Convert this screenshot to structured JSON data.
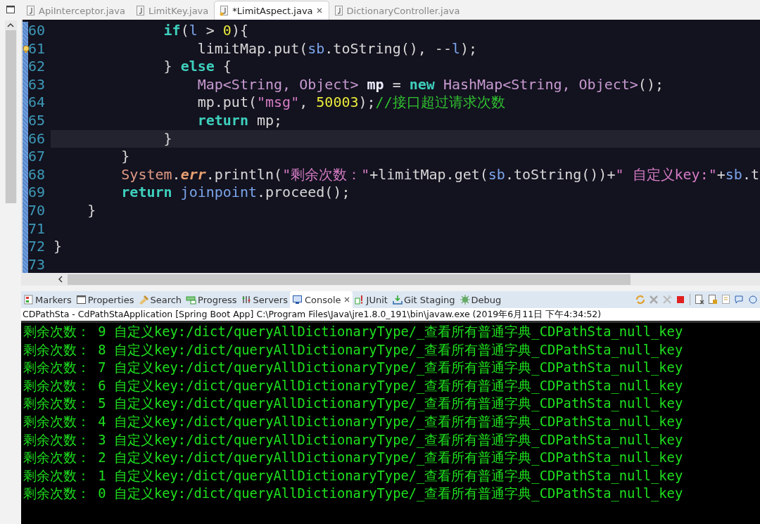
{
  "editor_tabs": [
    {
      "label": "ApiInterceptor.java",
      "selected": false
    },
    {
      "label": "LimitKey.java",
      "selected": false
    },
    {
      "label": "*LimitAspect.java",
      "selected": true
    },
    {
      "label": "DictionaryController.java",
      "selected": false
    }
  ],
  "code_lines": [
    {
      "number": "60",
      "current": false,
      "warning": false,
      "tokens": [
        {
          "kind": "kw",
          "text": "             if"
        },
        {
          "kind": "plain",
          "text": "("
        },
        {
          "kind": "var",
          "text": "l"
        },
        {
          "kind": "plain",
          "text": " > "
        },
        {
          "kind": "num",
          "text": "0"
        },
        {
          "kind": "plain",
          "text": "){"
        }
      ]
    },
    {
      "number": "61",
      "current": false,
      "warning": true,
      "tokens": [
        {
          "kind": "plain",
          "text": "                 limitMap.put("
        },
        {
          "kind": "var",
          "text": "sb"
        },
        {
          "kind": "plain",
          "text": ".toString(), --"
        },
        {
          "kind": "var",
          "text": "l"
        },
        {
          "kind": "plain",
          "text": ");"
        }
      ]
    },
    {
      "number": "62",
      "current": false,
      "warning": false,
      "tokens": [
        {
          "kind": "plain",
          "text": "             } "
        },
        {
          "kind": "kw",
          "text": "else"
        },
        {
          "kind": "plain",
          "text": " {"
        }
      ]
    },
    {
      "number": "63",
      "current": false,
      "warning": false,
      "tokens": [
        {
          "kind": "type",
          "text": "                 Map<String, Object>"
        },
        {
          "kind": "decl",
          "text": " mp"
        },
        {
          "kind": "plain",
          "text": " = "
        },
        {
          "kind": "kw",
          "text": "new"
        },
        {
          "kind": "type",
          "text": " HashMap<String, Object>"
        },
        {
          "kind": "plain",
          "text": "();"
        }
      ]
    },
    {
      "number": "64",
      "current": false,
      "warning": false,
      "tokens": [
        {
          "kind": "plain",
          "text": "                 mp.put("
        },
        {
          "kind": "str",
          "text": "\"msg\""
        },
        {
          "kind": "plain",
          "text": ", "
        },
        {
          "kind": "num",
          "text": "50003"
        },
        {
          "kind": "plain",
          "text": ");"
        },
        {
          "kind": "cmt",
          "text": "//接口超过请求次数"
        }
      ]
    },
    {
      "number": "65",
      "current": false,
      "warning": false,
      "tokens": [
        {
          "kind": "kw",
          "text": "                 return"
        },
        {
          "kind": "plain",
          "text": " mp;"
        }
      ]
    },
    {
      "number": "66",
      "current": true,
      "warning": false,
      "tokens": [
        {
          "kind": "plain",
          "text": "             }"
        }
      ]
    },
    {
      "number": "67",
      "current": false,
      "warning": false,
      "tokens": [
        {
          "kind": "plain",
          "text": "        }"
        }
      ]
    },
    {
      "number": "68",
      "current": false,
      "warning": false,
      "tokens": [
        {
          "kind": "cls",
          "text": "        System"
        },
        {
          "kind": "plain",
          "text": "."
        },
        {
          "kind": "fld",
          "text": "err"
        },
        {
          "kind": "plain",
          "text": ".println("
        },
        {
          "kind": "str",
          "text": "\"剩余次数：\""
        },
        {
          "kind": "plain",
          "text": "+limitMap.get("
        },
        {
          "kind": "var",
          "text": "sb"
        },
        {
          "kind": "plain",
          "text": ".toString())+"
        },
        {
          "kind": "str",
          "text": "\" 自定义key:\""
        },
        {
          "kind": "plain",
          "text": "+"
        },
        {
          "kind": "var",
          "text": "sb"
        },
        {
          "kind": "plain",
          "text": ".t"
        }
      ]
    },
    {
      "number": "69",
      "current": false,
      "warning": false,
      "tokens": [
        {
          "kind": "kw",
          "text": "        return"
        },
        {
          "kind": "var",
          "text": " joinpoint"
        },
        {
          "kind": "plain",
          "text": ".proceed();"
        }
      ]
    },
    {
      "number": "70",
      "current": false,
      "warning": false,
      "tokens": [
        {
          "kind": "plain",
          "text": "    }"
        }
      ]
    },
    {
      "number": "71",
      "current": false,
      "warning": false
    },
    {
      "number": "72",
      "current": false,
      "warning": false,
      "tokens": [
        {
          "kind": "plain",
          "text": "}"
        }
      ]
    },
    {
      "number": "73",
      "current": false,
      "warning": false
    }
  ],
  "panel_tabs": [
    {
      "label": "Markers",
      "selected": false
    },
    {
      "label": "Properties",
      "selected": false
    },
    {
      "label": "Search",
      "selected": false
    },
    {
      "label": "Progress",
      "selected": false
    },
    {
      "label": "Servers",
      "selected": false
    },
    {
      "label": "Console",
      "selected": true
    },
    {
      "label": "JUnit",
      "selected": false
    },
    {
      "label": "Git Staging",
      "selected": false
    },
    {
      "label": "Debug",
      "selected": false
    }
  ],
  "console": {
    "header": "CDPathSta - CdPathStaApplication [Spring Boot App] C:\\Program Files\\Java\\jre1.8.0_191\\bin\\javaw.exe (2019年6月11日 下午4:34:52)",
    "lines": [
      "剩余次数： 9 自定义key:/dict/queryAllDictionaryType/_查看所有普通字典_CDPathSta_null_key",
      "剩余次数： 8 自定义key:/dict/queryAllDictionaryType/_查看所有普通字典_CDPathSta_null_key",
      "剩余次数： 7 自定义key:/dict/queryAllDictionaryType/_查看所有普通字典_CDPathSta_null_key",
      "剩余次数： 6 自定义key:/dict/queryAllDictionaryType/_查看所有普通字典_CDPathSta_null_key",
      "剩余次数： 5 自定义key:/dict/queryAllDictionaryType/_查看所有普通字典_CDPathSta_null_key",
      "剩余次数： 4 自定义key:/dict/queryAllDictionaryType/_查看所有普通字典_CDPathSta_null_key",
      "剩余次数： 3 自定义key:/dict/queryAllDictionaryType/_查看所有普通字典_CDPathSta_null_key",
      "剩余次数： 2 自定义key:/dict/queryAllDictionaryType/_查看所有普通字典_CDPathSta_null_key",
      "剩余次数： 1 自定义key:/dict/queryAllDictionaryType/_查看所有普通字典_CDPathSta_null_key",
      "剩余次数： 0 自定义key:/dict/queryAllDictionaryType/_查看所有普通字典_CDPathSta_null_key"
    ]
  }
}
